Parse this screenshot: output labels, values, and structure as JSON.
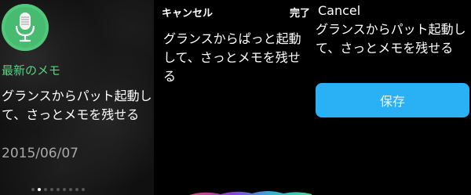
{
  "glance": {
    "title": "最新のメモ",
    "body": "グランスからパット起動して、さっとメモを残せる",
    "date": "2015/06/07",
    "page_dots_count": 9,
    "active_dot_index": 1,
    "icon": "microphone-icon",
    "accent_color": "#57d27f"
  },
  "dictation": {
    "cancel_label": "キャンセル",
    "done_label": "完了",
    "text": "グランスからぱっと起動して、さっとメモを残せる"
  },
  "confirm": {
    "cancel_label": "Cancel",
    "text": "グランスからパット起動して、さっとメモを残せる",
    "save_label": "保存",
    "button_color": "#2ab0f5"
  }
}
